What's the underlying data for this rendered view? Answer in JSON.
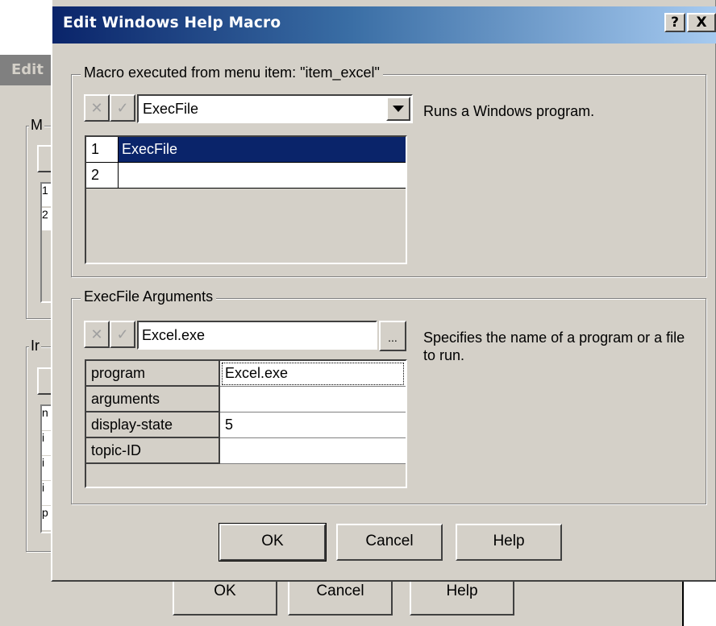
{
  "background_dialog": {
    "title": "Edit",
    "group1_legend_fragment": "M",
    "group2_legend_fragment": "Ir",
    "list1_fragments": [
      "1",
      "2"
    ],
    "list2_fragments": [
      "n",
      "i",
      "i",
      "i",
      "p"
    ],
    "buttons": {
      "ok": "OK",
      "cancel": "Cancel",
      "help": "Help"
    }
  },
  "dialog": {
    "title": "Edit Windows Help Macro",
    "caption_buttons": {
      "help": "?",
      "close": "X"
    },
    "macro_group": {
      "legend": "Macro executed from menu item: \"item_excel\"",
      "selected_macro": "ExecFile",
      "description": "Runs a Windows program.",
      "list": [
        {
          "num": "1",
          "value": "ExecFile",
          "selected": true
        },
        {
          "num": "2",
          "value": "",
          "selected": false
        }
      ]
    },
    "args_group": {
      "legend": "ExecFile Arguments",
      "input_value": "Excel.exe",
      "browse_label": "...",
      "description": "Specifies the name of a program or a file to run.",
      "rows": [
        {
          "name": "program",
          "value": "Excel.exe"
        },
        {
          "name": "arguments",
          "value": ""
        },
        {
          "name": "display-state",
          "value": "5"
        },
        {
          "name": "topic-ID",
          "value": ""
        }
      ]
    },
    "buttons": {
      "ok": "OK",
      "cancel": "Cancel",
      "help": "Help"
    }
  },
  "icons": {
    "cancel_edit": "x-icon",
    "accept_edit": "check-icon",
    "dropdown": "chevron-down-icon"
  },
  "colors": {
    "face": "#d4d0c8",
    "title_start": "#0a246a",
    "title_end": "#a6caf0",
    "selection": "#0a246a"
  }
}
